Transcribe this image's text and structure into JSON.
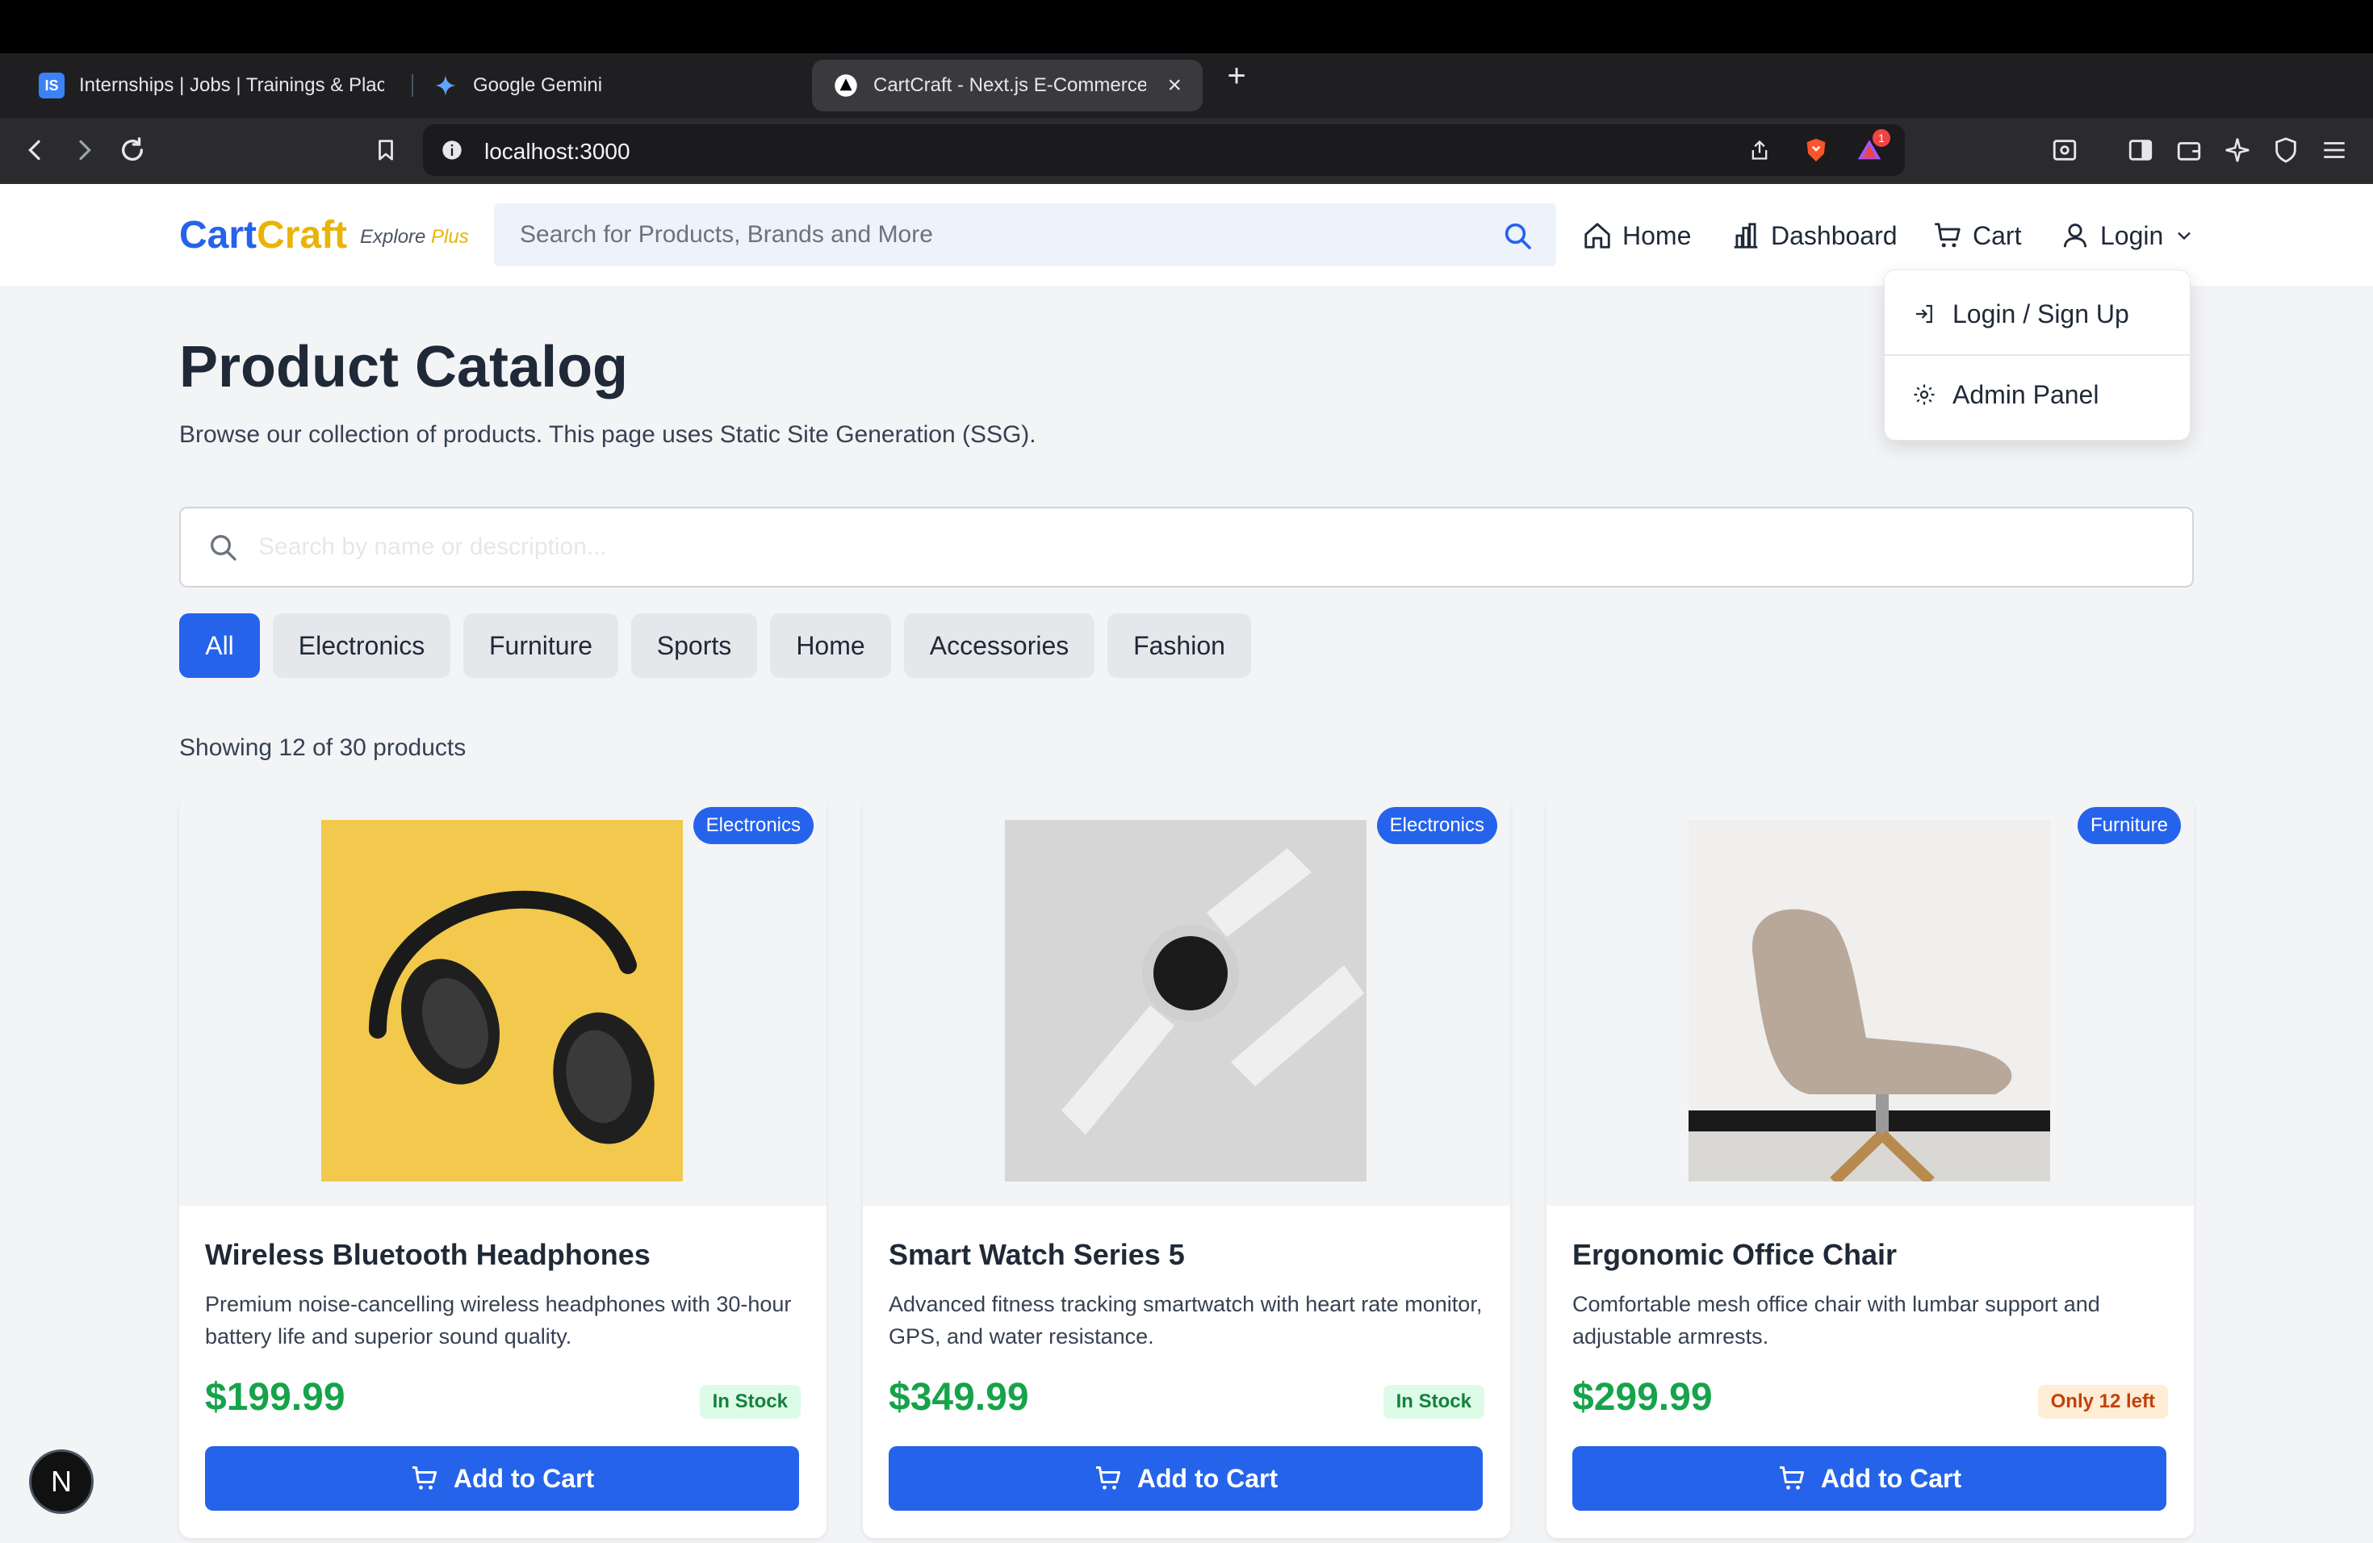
{
  "browser": {
    "tabs": [
      {
        "favicon": "IS",
        "title": "Internships | Jobs | Trainings & Plac"
      },
      {
        "favicon": "gemini-icon",
        "title": "Google Gemini"
      },
      {
        "favicon": "nextjs-icon",
        "title": "CartCraft - Next.js E-Commerce"
      }
    ],
    "url": "localhost:3000",
    "shields_count": "1"
  },
  "header": {
    "logo_part1": "Cart",
    "logo_part2": "Craft",
    "tagline_explore": "Explore",
    "tagline_plus": "Plus",
    "search_placeholder": "Search for Products, Brands and More",
    "nav": {
      "home": "Home",
      "dashboard": "Dashboard",
      "cart": "Cart",
      "login": "Login"
    }
  },
  "dropdown": {
    "items": [
      {
        "label": "Login / Sign Up",
        "icon": "login-icon"
      },
      {
        "label": "Admin Panel",
        "icon": "gear-icon"
      }
    ]
  },
  "main": {
    "title": "Product Catalog",
    "subtitle": "Browse our collection of products. This page uses Static Site Generation (SSG).",
    "search_placeholder": "Search by name or description...",
    "categories": [
      "All",
      "Electronics",
      "Furniture",
      "Sports",
      "Home",
      "Accessories",
      "Fashion"
    ],
    "active_category": "All",
    "showing": "Showing 12 of 30 products"
  },
  "products": [
    {
      "name": "Wireless Bluetooth Headphones",
      "category": "Electronics",
      "description": "Premium noise-cancelling wireless headphones with 30-hour battery life and superior sound quality.",
      "price": "$199.99",
      "stock": "In Stock",
      "add_label": "Add to Cart"
    },
    {
      "name": "Smart Watch Series 5",
      "category": "Electronics",
      "description": "Advanced fitness tracking smartwatch with heart rate monitor, GPS, and water resistance.",
      "price": "$349.99",
      "stock": "In Stock",
      "add_label": "Add to Cart"
    },
    {
      "name": "Ergonomic Office Chair",
      "category": "Furniture",
      "description": "Comfortable mesh office chair with lumbar support and adjustable armrests.",
      "price": "$299.99",
      "stock": "Only 12 left",
      "add_label": "Add to Cart"
    }
  ],
  "dev_badge": "N",
  "colors": {
    "primary": "#2563eb",
    "accent": "#eab308",
    "price": "#16a34a"
  }
}
